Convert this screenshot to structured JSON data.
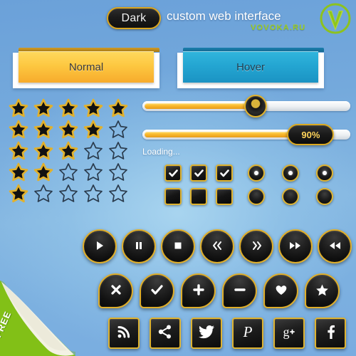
{
  "header": {
    "badge_label": "Dark",
    "title": "custom web interface",
    "brand": "VOVOKA.RU",
    "logo_icon": "v-check-logo-icon",
    "badge_border_color": "#d9a520",
    "badge_bg_color": "#101010",
    "brand_color": "#9ccb25"
  },
  "ribbons": [
    {
      "label": "Normal",
      "state": "normal",
      "accent_color": "#f7ab2c"
    },
    {
      "label": "Hover",
      "state": "hover",
      "accent_color": "#1b93c3"
    }
  ],
  "stars": {
    "max": 5,
    "filled_color": "#111111",
    "border_color": "#e2b12c",
    "rows": [
      5,
      4,
      3,
      2,
      1
    ]
  },
  "slider": {
    "name": "volume-slider",
    "value": 55,
    "min": 0,
    "max": 100,
    "fill_color": "#f9b92f"
  },
  "progress": {
    "name": "loading-progress",
    "value": 90,
    "value_label": "90%",
    "status_text": "Loading...",
    "fill_color": "#f9b92f"
  },
  "checkboxes": {
    "checked": [
      true,
      true,
      true
    ],
    "unchecked": [
      false,
      false,
      false
    ],
    "check_icon": "check-icon"
  },
  "radios": {
    "selected": [
      true,
      true,
      true
    ],
    "unselected": [
      false,
      false,
      false
    ]
  },
  "media_buttons": [
    {
      "label": "Play",
      "icon": "play-icon",
      "glyph": "▶"
    },
    {
      "label": "Pause",
      "icon": "pause-icon",
      "glyph": "▐▌"
    },
    {
      "label": "Stop",
      "icon": "stop-icon",
      "glyph": "■"
    },
    {
      "label": "Previous",
      "icon": "double-chevron-left-icon",
      "glyph": "«"
    },
    {
      "label": "Next",
      "icon": "double-chevron-right-icon",
      "glyph": "»"
    },
    {
      "label": "Fast Forward",
      "icon": "fast-forward-icon",
      "glyph": "▶▶"
    },
    {
      "label": "Rewind",
      "icon": "rewind-icon",
      "glyph": "◀◀"
    }
  ],
  "action_buttons": [
    {
      "label": "Close",
      "icon": "close-x-icon",
      "glyph": "✖"
    },
    {
      "label": "Confirm",
      "icon": "check-icon",
      "glyph": "✔"
    },
    {
      "label": "Add",
      "icon": "plus-icon",
      "glyph": "✚"
    },
    {
      "label": "Remove",
      "icon": "minus-icon",
      "glyph": "➖"
    },
    {
      "label": "Favorite",
      "icon": "heart-icon",
      "glyph": "♥"
    },
    {
      "label": "Star",
      "icon": "star-icon",
      "glyph": "★"
    }
  ],
  "social_buttons": [
    {
      "label": "RSS",
      "icon": "rss-icon"
    },
    {
      "label": "Share",
      "icon": "share-icon"
    },
    {
      "label": "Twitter",
      "icon": "twitter-icon"
    },
    {
      "label": "Pinterest",
      "icon": "pinterest-icon"
    },
    {
      "label": "Google Plus",
      "icon": "google-plus-icon"
    },
    {
      "label": "Facebook",
      "icon": "facebook-icon"
    }
  ],
  "corner_ribbon": {
    "label": "FREE",
    "color": "#86c51c"
  }
}
